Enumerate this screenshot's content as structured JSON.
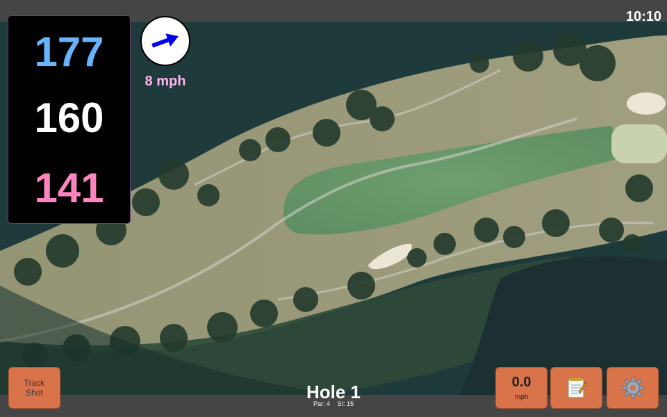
{
  "status": {
    "time": "10:10"
  },
  "distances": {
    "back": "177",
    "center": "160",
    "front": "141"
  },
  "wind": {
    "speed_text": "8 mph",
    "icon": "wind-direction-arrow-icon"
  },
  "hole": {
    "title": "Hole 1",
    "par": "Par: 4",
    "si": "SI: 15"
  },
  "buttons": {
    "track_shot_label": "Track\nShot",
    "speed_value": "0.0",
    "speed_unit": "mph",
    "notes_icon": "notepad-icon",
    "settings_icon": "gear-icon"
  },
  "colors": {
    "back": "#66b3ff",
    "center": "#ffffff",
    "front": "#ff85c0",
    "wind_text": "#ffb3f0",
    "wind_arrow": "#0000ee",
    "button": "#d9734a"
  }
}
